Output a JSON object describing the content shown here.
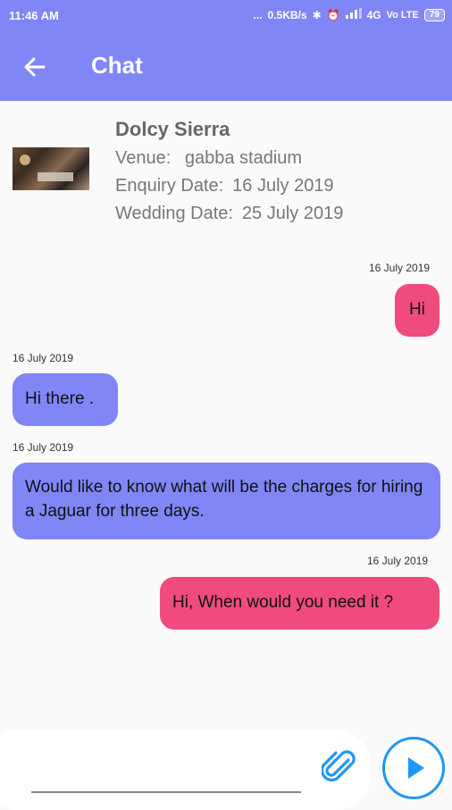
{
  "status_bar": {
    "time": "11:46 AM",
    "dots": "...",
    "net_speed": "0.5KB/s",
    "network": "4G",
    "volte": "Vo LTE",
    "battery": "79"
  },
  "header": {
    "title": "Chat",
    "back_icon": "arrow-left-icon"
  },
  "enquiry": {
    "vendor_name": "Dolcy Sierra",
    "venue_label": "Venue:",
    "venue": "gabba stadium",
    "enquiry_date_label": "Enquiry Date:",
    "enquiry_date": "16 July 2019",
    "wedding_date_label": "Wedding Date:",
    "wedding_date": "25 July 2019"
  },
  "messages": [
    {
      "direction": "outgoing",
      "time": "16 July 2019",
      "text": "Hi"
    },
    {
      "direction": "incoming",
      "time": "16 July 2019",
      "text": "Hi there ."
    },
    {
      "direction": "incoming",
      "time": "16 July 2019",
      "text": "Would like to know what will be the charges for hiring a Jaguar for three days."
    },
    {
      "direction": "outgoing",
      "time": "16 July 2019",
      "text": "Hi, When would you need it ?"
    }
  ],
  "composer": {
    "placeholder": "",
    "attach_icon": "paperclip-icon",
    "send_icon": "play-send-icon"
  },
  "colors": {
    "header": "#8086f5",
    "incoming_bubble": "#8086f5",
    "outgoing_bubble": "#ef4b7c",
    "send_button": "#2196f3"
  }
}
